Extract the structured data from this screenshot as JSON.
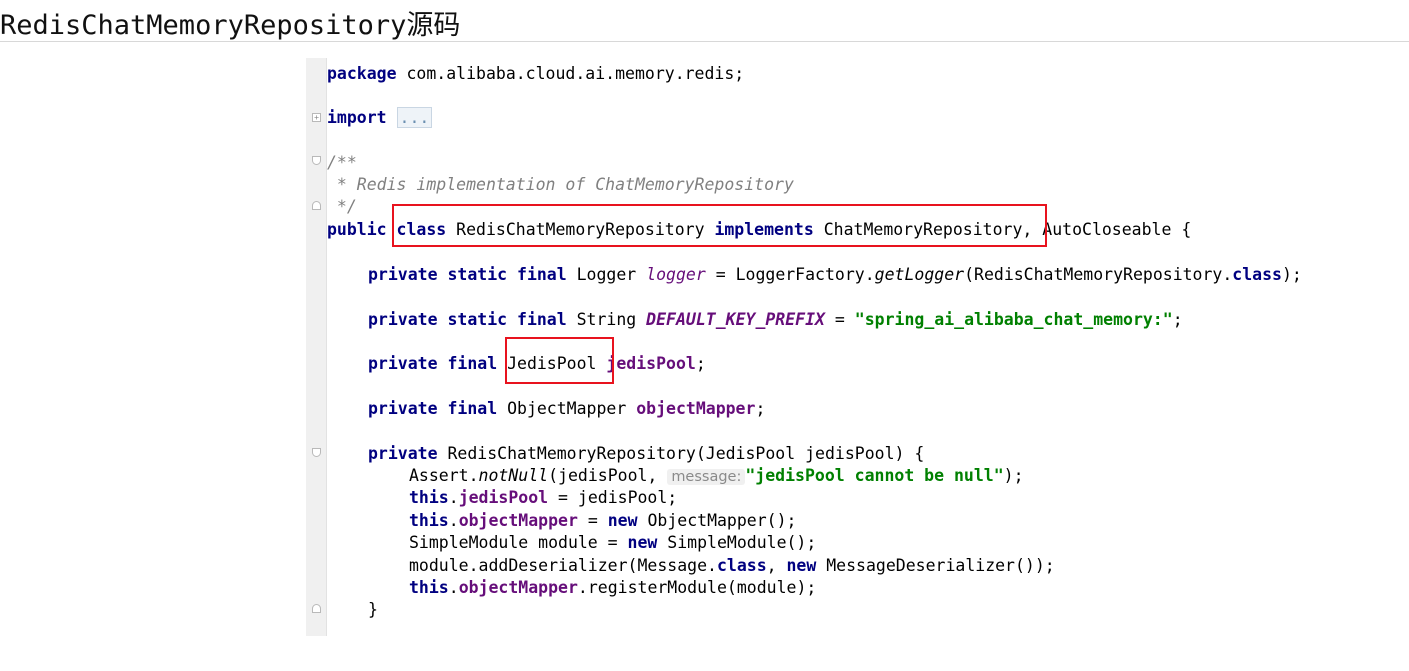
{
  "article": {
    "heading": "RedisChatMemoryRepository源码"
  },
  "code": {
    "l1": {
      "kw": "package",
      "rest": " com.alibaba.cloud.ai.memory.redis;"
    },
    "l2": {
      "kw": "import",
      "folded": "..."
    },
    "l3": "/**",
    "l4": " * Redis implementation of ChatMemoryRepository",
    "l5": " */",
    "l6": {
      "kw1": "public",
      "kw2": "class",
      "name": " RedisChatMemoryRepository ",
      "kw3": "implements",
      "iface": " ChatMemoryRepository",
      "rest": ", AutoCloseable {"
    },
    "l7": {
      "kw1": "private static final",
      "type": " Logger ",
      "field": "logger",
      "eq": " = LoggerFactory.",
      "method": "getLogger",
      "arg": "(RedisChatMemoryRepository.",
      "kwc": "class",
      "end": ");"
    },
    "l8": {
      "kw1": "private static final",
      "type": " String ",
      "field": "DEFAULT_KEY_PREFIX",
      "eq": " = ",
      "str": "\"spring_ai_alibaba_chat_memory:\"",
      "end": ";"
    },
    "l9": {
      "kw1": "private final",
      "type": " JedisPool",
      "field": " jedisPool",
      "end": ";"
    },
    "l10": {
      "kw1": "private final",
      "type": " ObjectMapper ",
      "field": "objectMapper",
      "end": ";"
    },
    "l11": {
      "kw1": "private",
      "rest": " RedisChatMemoryRepository(JedisPool jedisPool) {"
    },
    "l12": {
      "pre": "Assert.",
      "method": "notNull",
      "mid": "(jedisPool, ",
      "hint": "message:",
      "str": "\"jedisPool cannot be null\"",
      "end": ");"
    },
    "l13": {
      "kw": "this",
      "dot": ".",
      "field": "jedisPool",
      "rest": " = jedisPool;"
    },
    "l14": {
      "kw": "this",
      "dot": ".",
      "field": "objectMapper",
      "mid": " = ",
      "kw2": "new",
      "rest": " ObjectMapper();"
    },
    "l15": {
      "pre": "SimpleModule module = ",
      "kw": "new",
      "rest": " SimpleModule();"
    },
    "l16": {
      "pre": "module.addDeserializer(Message.",
      "kw": "class",
      "mid": ", ",
      "kw2": "new",
      "rest": " MessageDeserializer());"
    },
    "l17": {
      "kw": "this",
      "dot": ".",
      "field": "objectMapper",
      "rest": ".registerModule(module);"
    },
    "l18": "}"
  },
  "colors": {
    "keyword": "#000080",
    "field": "#660e7a",
    "string": "#008000",
    "comment": "#808080",
    "highlight_box": "#e8131e"
  }
}
